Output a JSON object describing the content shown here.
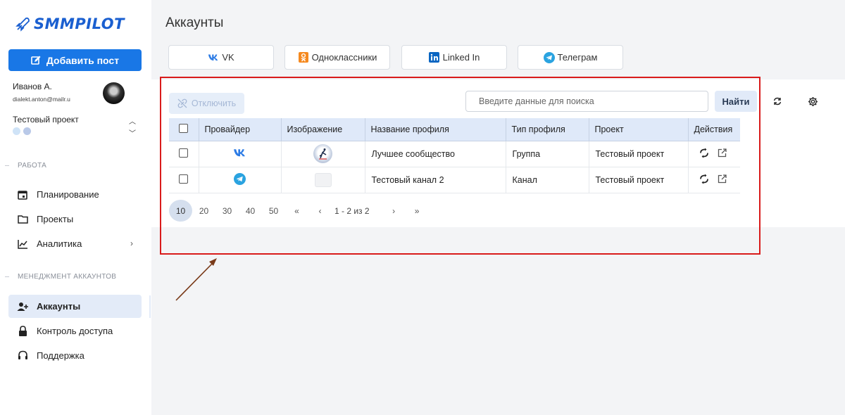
{
  "app": {
    "logo_text": "SMMPILOT",
    "brand_color": "#1a5fd0",
    "accent": "#1977e6"
  },
  "sidebar": {
    "add_post_label": "Добавить пост",
    "user": {
      "name": "Иванов А.",
      "email": "dialekt.anton@mailr.u"
    },
    "project": {
      "name": "Тестовый проект"
    },
    "sections": {
      "work": "РАБОТА",
      "accounts_mgmt": "МЕНЕДЖМЕНТ АККАУНТОВ"
    },
    "items": [
      {
        "label": "Планирование",
        "icon": "calendar-icon"
      },
      {
        "label": "Проекты",
        "icon": "folder-icon"
      },
      {
        "label": "Аналитика",
        "icon": "chart-line-icon"
      },
      {
        "label": "Аккаунты",
        "icon": "person-add-icon",
        "active": true
      },
      {
        "label": "Контроль доступа",
        "icon": "lock-icon"
      },
      {
        "label": "Поддержка",
        "icon": "headset-icon"
      }
    ]
  },
  "main": {
    "title": "Аккаунты",
    "providers": [
      {
        "label": "VK",
        "icon": "vk-icon"
      },
      {
        "label": "Одноклассники",
        "icon": "odnoklassniki-icon"
      },
      {
        "label": "Linked In",
        "icon": "linkedin-icon"
      },
      {
        "label": "Телеграм",
        "icon": "telegram-icon"
      }
    ],
    "disconnect_label": "Отключить",
    "search": {
      "placeholder": "Введите данные для поиска",
      "button": "Найти"
    },
    "table": {
      "headers": [
        "Провайдер",
        "Изображение",
        "Название профиля",
        "Тип профиля",
        "Проект",
        "Действия"
      ],
      "rows": [
        {
          "provider": "vk-icon",
          "name": "Лучшее сообщество",
          "type": "Группа",
          "project": "Тестовый проект"
        },
        {
          "provider": "telegram-icon",
          "name": "Тестовый канал 2",
          "type": "Канал",
          "project": "Тестовый проект"
        }
      ]
    },
    "pagination": {
      "page_sizes": [
        "10",
        "20",
        "30",
        "40",
        "50"
      ],
      "selected": "10",
      "first": "«",
      "prev": "‹",
      "next": "›",
      "last": "»",
      "range": "1 - 2 из 2"
    }
  }
}
